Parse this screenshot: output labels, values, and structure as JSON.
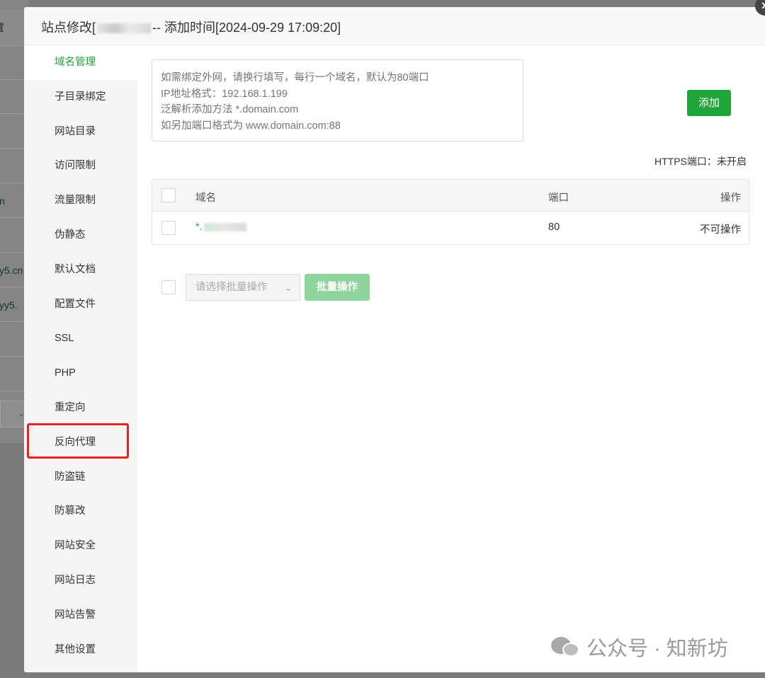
{
  "background": {
    "header_text": "置",
    "cells": [
      "",
      "",
      "n",
      "cn",
      "n",
      "yy5.cn",
      "zyy5.",
      "",
      ""
    ]
  },
  "dialog": {
    "title_prefix": "站点修改[",
    "title_suffix": "-- 添加时间[2024-09-29 17:09:20]",
    "close_label": "×"
  },
  "sidebar": {
    "items": [
      {
        "label": "域名管理",
        "active": true
      },
      {
        "label": "子目录绑定"
      },
      {
        "label": "网站目录"
      },
      {
        "label": "访问限制"
      },
      {
        "label": "流量限制"
      },
      {
        "label": "伪静态"
      },
      {
        "label": "默认文档"
      },
      {
        "label": "配置文件"
      },
      {
        "label": "SSL"
      },
      {
        "label": "PHP"
      },
      {
        "label": "重定向"
      },
      {
        "label": "反向代理",
        "highlighted": true
      },
      {
        "label": "防盗链"
      },
      {
        "label": "防篡改"
      },
      {
        "label": "网站安全"
      },
      {
        "label": "网站日志"
      },
      {
        "label": "网站告警"
      },
      {
        "label": "其他设置"
      }
    ]
  },
  "domain_form": {
    "placeholder": "如需绑定外网，请换行填写，每行一个域名，默认为80端口\nIP地址格式：192.168.1.199\n泛解析添加方法 *.domain.com\n如另加端口格式为 www.domain.com:88",
    "add_label": "添加",
    "https_label": "HTTPS端口：未开启"
  },
  "table": {
    "headers": {
      "domain": "域名",
      "port": "端口",
      "action": "操作"
    },
    "rows": [
      {
        "domain": "*.",
        "port": "80",
        "action": "不可操作"
      }
    ]
  },
  "batch": {
    "select_placeholder": "请选择批量操作",
    "button_label": "批量操作"
  },
  "watermark": {
    "text": "公众号 · 知新坊"
  },
  "colors": {
    "accent": "#20a53a",
    "highlight": "#e82121"
  }
}
